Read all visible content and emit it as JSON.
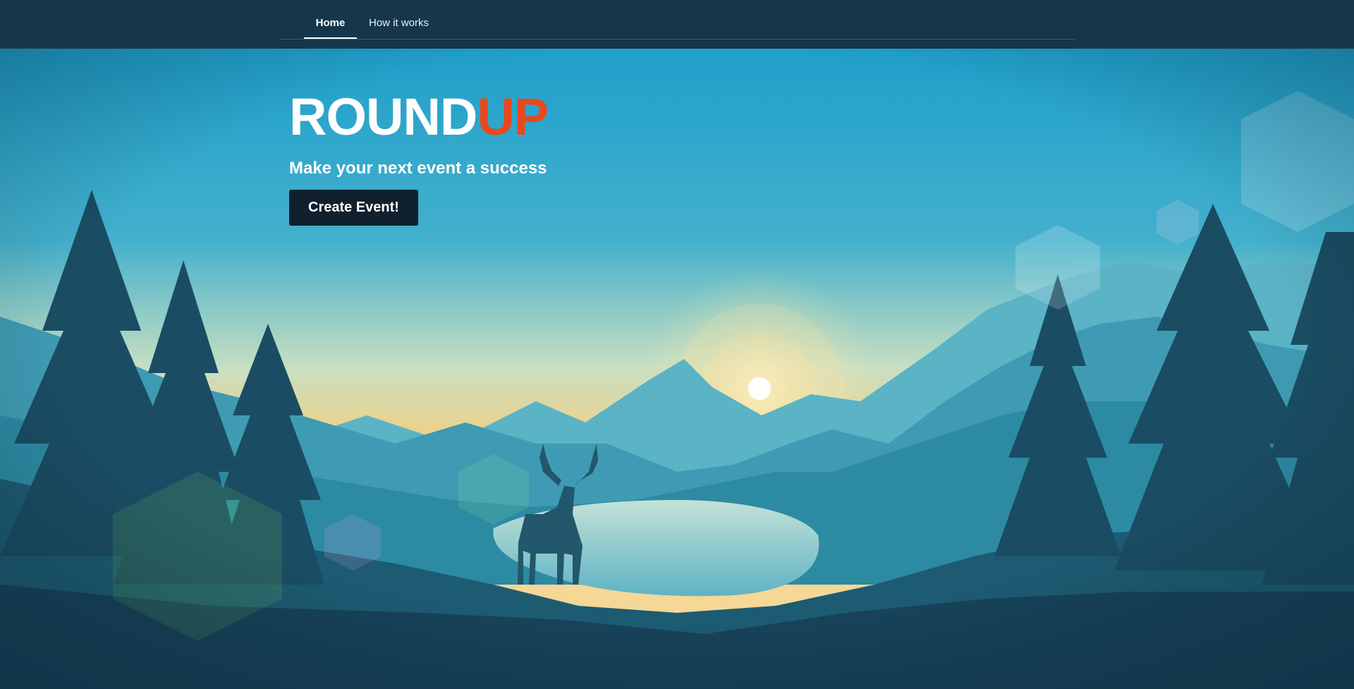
{
  "nav": {
    "tabs": [
      {
        "label": "Home",
        "active": true
      },
      {
        "label": "How it works",
        "active": false
      }
    ]
  },
  "hero": {
    "brand_main": "ROUND",
    "brand_accent": "UP",
    "tagline": "Make your next event a success",
    "cta_label": "Create Event!"
  },
  "colors": {
    "navbar": "#16364c",
    "brand_accent": "#e8481c",
    "button": "#10202e",
    "sky_top": "#1f9fcb",
    "sky_horizon": "#f4cf7f",
    "forest": "#17435a"
  }
}
